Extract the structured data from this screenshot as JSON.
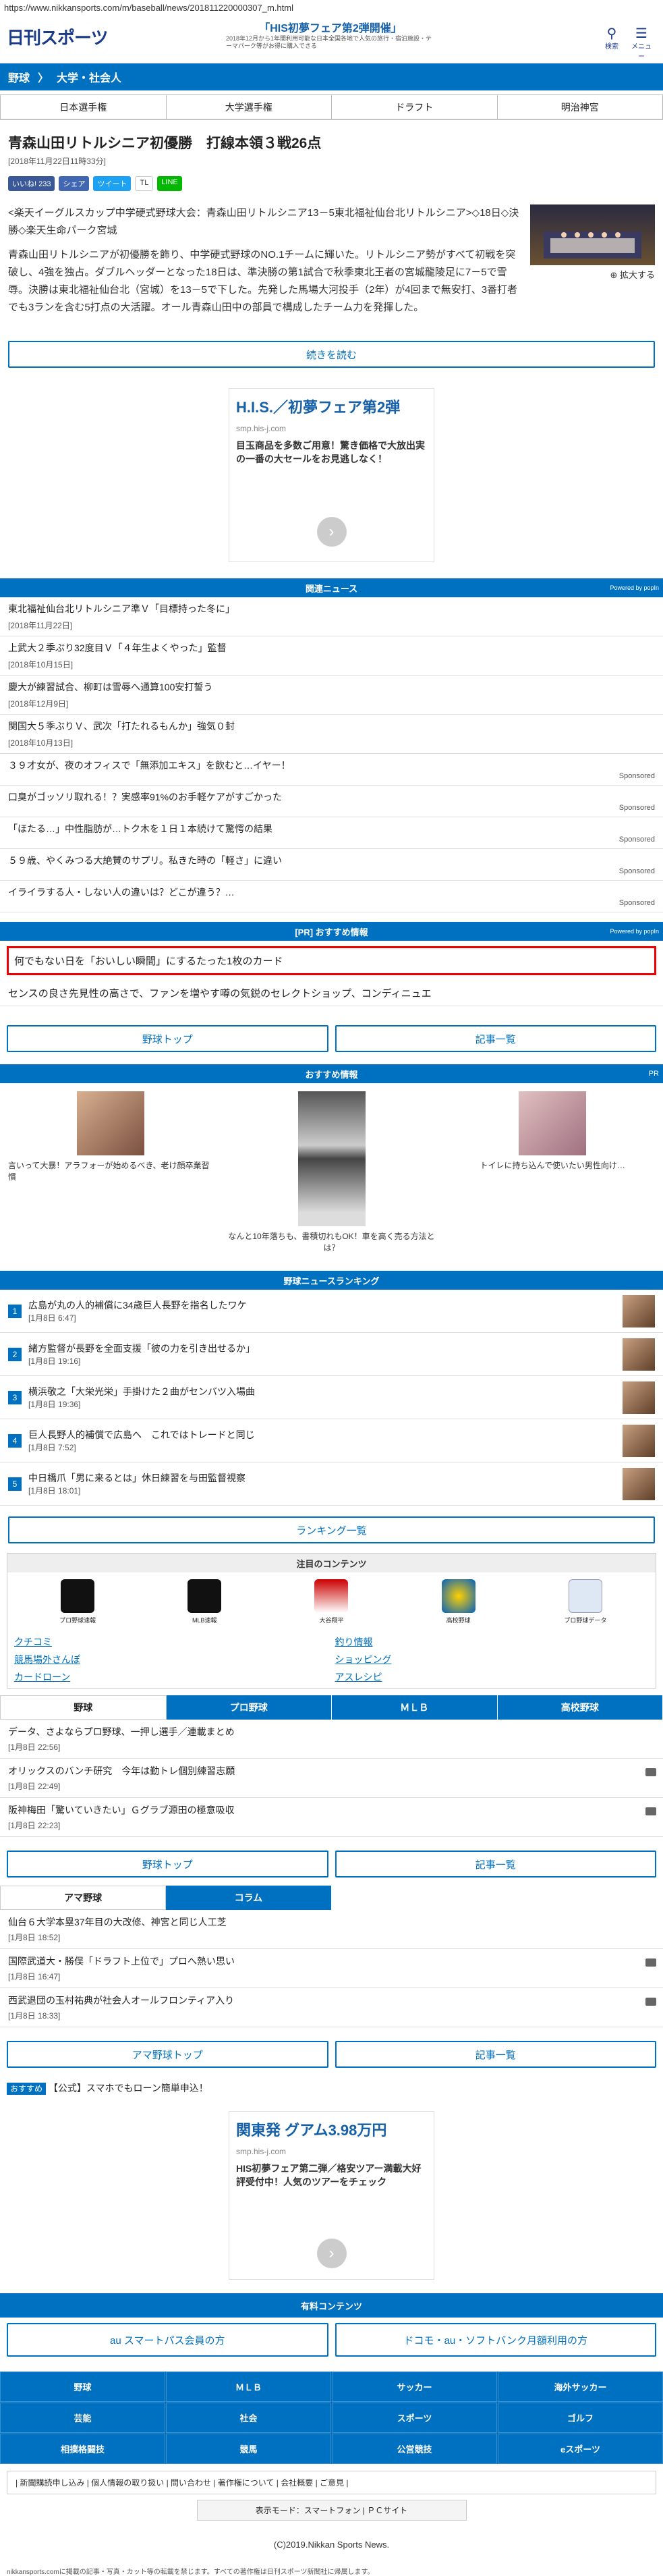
{
  "url": "https://www.nikkansports.com/m/baseball/news/201811220000307_m.html",
  "header": {
    "logo": "日刊スポーツ",
    "ad_title": "「HIS初夢フェア第2弾開催」",
    "ad_sub": "2018年12月から1年間利用可能な日本全国各地で人気の旅行・宿泊施設・テーマパーク等がお得に購入できる",
    "search_label": "検索",
    "menu_label": "メニュー"
  },
  "breadcrumb": [
    "野球",
    "大学・社会人"
  ],
  "subnav": [
    "日本選手権",
    "大学選手権",
    "ドラフト",
    "明治神宮"
  ],
  "article": {
    "title": "青森山田リトルシニア初優勝　打線本領３戦26点",
    "date": "[2018年11月22日11時33分]",
    "social": [
      "いいね! 233",
      "シェア",
      "ツイート",
      "TL",
      "LINE"
    ],
    "lead": "<楽天イーグルスカップ中学硬式野球大会：青森山田リトルシニア13－5東北福祉仙台北リトルシニア>◇18日◇決勝◇楽天生命パーク宮城",
    "body": "青森山田リトルシニアが初優勝を飾り、中学硬式野球のNO.1チームに輝いた。リトルシニア勢がすべて初戦を突破し、4強を独占。ダブルヘッダーとなった18日は、準決勝の第1試合で秋季東北王者の宮城龍陵足に7－5で雪辱。決勝は東北福祉仙台北（宮城）を13－5で下した。先発した馬場大河投手（2年）が4回まで無安打、3番打者でも3ランを含む5打点の大活躍。オール青森山田中の部員で構成したチーム力を発揮した。",
    "photo_caption": "拡大する",
    "read_more": "続きを読む"
  },
  "ad1": {
    "title": "H.I.S.／初夢フェア第2弾",
    "url": "smp.his-j.com",
    "body": "目玉商品を多数ご用意！驚き価格で大放出実の一番の大セールをお見逃しなく！",
    "arrow": "›"
  },
  "related": {
    "title": "関連ニュース",
    "powered": "Powered by popIn",
    "items": [
      {
        "t": "東北福祉仙台北リトルシニア準Ｖ「目標持った冬に」",
        "d": "[2018年11月22日]"
      },
      {
        "t": "上武大２季ぶり32度目Ｖ「４年生よくやった」監督",
        "d": "[2018年10月15日]"
      },
      {
        "t": "慶大が練習試合、柳町は雪辱へ通算100安打誓う",
        "d": "[2018年12月9日]"
      },
      {
        "t": "関国大５季ぶりＶ、武次「打たれるもんか」強気０封",
        "d": "[2018年10月13日]"
      }
    ],
    "sponsored": [
      "３９才女が、夜のオフィスで「無添加エキス」を飲むと…イヤー！",
      "口臭がゴッソリ取れる！？実感率91%のお手軽ケアがすごかった",
      "「ほたる…」中性脂肪が…トク木を１日１本続けて驚愕の結果",
      "５９歳、やくみつる大絶賛のサプリ。私きた時の「軽さ」に違い",
      "イライラする人・しない人の違いは？どこが違う？…"
    ],
    "sponsored_label": "Sponsored"
  },
  "pr": {
    "title": "[PR] おすすめ情報",
    "powered": "Powered by popIn",
    "highlight": "何でもない日を「おいしい瞬間」にするたった1枚のカード",
    "second": "センスの良さ先見性の高さで、ファンを増やす噂の気鋭のセレクトショップ、コンディニュエ"
  },
  "buttons1": [
    "野球トップ",
    "記事一覧"
  ],
  "recommend": {
    "title": "おすすめ情報",
    "pr": "PR",
    "items": [
      "言いって大暴！アラフォーが始めるべき、老け顔卒業習慣",
      "なんと10年落ちも、書積切れもOK！車を高く売る方法とは？",
      "トイレに持ち込んで使いたい男性向け…"
    ]
  },
  "ranking": {
    "title": "野球ニュースランキング",
    "items": [
      {
        "n": "1",
        "t": "広島が丸の人的補償に34歳巨人長野を指名したワケ",
        "d": "[1月8日 6:47]"
      },
      {
        "n": "2",
        "t": "緒方監督が長野を全面支援「彼の力を引き出せるか」",
        "d": "[1月8日 19:16]"
      },
      {
        "n": "3",
        "t": "横浜敬之「大栄光栄」手掛けた２曲がセンバツ入場曲",
        "d": "[1月8日 19:36]"
      },
      {
        "n": "4",
        "t": "巨人長野人的補償で広島へ　これではトレードと同じ",
        "d": "[1月8日 7:52]"
      },
      {
        "n": "5",
        "t": "中日橋爪「男に来るとは」休日練習を与田監督視察",
        "d": "[1月8日 18:01]"
      }
    ],
    "more": "ランキング一覧"
  },
  "chuumoku": {
    "title": "注目のコンテンツ",
    "icons": [
      "プロ野球速報",
      "MLB速報",
      "大谷翔平",
      "高校野球",
      "プロ野球データ"
    ],
    "links": [
      "クチコミ",
      "釣り情報",
      "競馬場外さんぽ",
      "ショッピング",
      "カードローン",
      "アスレシピ"
    ]
  },
  "tabs1": [
    "野球",
    "プロ野球",
    "ＭＬＢ",
    "高校野球"
  ],
  "news1": [
    {
      "t": "データ、さよならプロ野球、一押し選手／連載まとめ",
      "d": "[1月8日 22:56]"
    },
    {
      "t": "オリックスのバンチ研究　今年は勤トレ個別練習志願",
      "d": "[1月8日 22:49]"
    },
    {
      "t": "阪神梅田「驚いていきたい」Ｇグラブ源田の極意吸収",
      "d": "[1月8日 22:23]"
    }
  ],
  "buttons2": [
    "野球トップ",
    "記事一覧"
  ],
  "tabs2": [
    "アマ野球",
    "コラム"
  ],
  "news2": [
    {
      "t": "仙台６大学本塁37年目の大改修、神宮と同じ人工芝",
      "d": "[1月8日 18:52]"
    },
    {
      "t": "国際武道大・勝俣「ドラフト上位で」プロへ熱い思い",
      "d": "[1月8日 16:47]"
    },
    {
      "t": "西武退団の玉村祐典が社会人オールフロンティア入り",
      "d": "[1月8日 18:33]"
    }
  ],
  "buttons3": [
    "アマ野球トップ",
    "記事一覧"
  ],
  "osusume": {
    "tag": "おすすめ",
    "text": "【公式】スマホでもローン簡単申込！"
  },
  "ad2": {
    "title": "関東発 グアム3.98万円",
    "url": "smp.his-j.com",
    "body": "HIS初夢フェア第二弾／格安ツアー満載大好評受付中！人気のツアーをチェック",
    "arrow": "›"
  },
  "paid": {
    "title": "有料コンテンツ",
    "items": [
      "au スマートパス会員の方",
      "ドコモ・au・ソフトバンク月額利用の方"
    ]
  },
  "footer_nav": [
    "野球",
    "ＭＬＢ",
    "サッカー",
    "海外サッカー",
    "芸能",
    "社会",
    "スポーツ",
    "ゴルフ",
    "相撲格闘技",
    "競馬",
    "公営競技",
    "eスポーツ"
  ],
  "foot_links": "| 新聞購読申し込み | 個人情報の取り扱い | 問い合わせ | 著作権について | 会社概要 | ご意見 |",
  "display_mode": "表示モード：スマートフォン | ＰＣサイト",
  "copyright": "(C)2019.Nikkan Sports News.",
  "bottom_note": "nikkansports.comに掲載の記事・写真・カット等の転載を禁じます。すべての著作権は日刊スポーツ新聞社に帰属します。"
}
